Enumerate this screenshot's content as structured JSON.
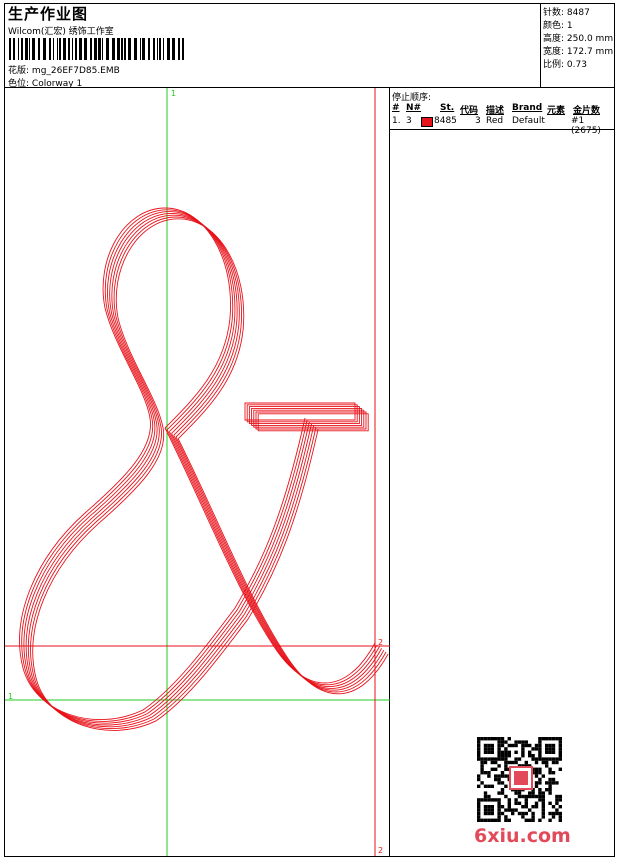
{
  "header": {
    "title": "生产作业图",
    "company": "Wilcom(汇宏) 绣饰工作室",
    "design_label": "花版:",
    "design_name": "mg_26EF7D85.EMB",
    "colorway_label": "色位:",
    "colorway_name": "Colorway 1"
  },
  "stats": [
    {
      "label": "针数:",
      "value": "8487"
    },
    {
      "label": "颜色:",
      "value": "1"
    },
    {
      "label": "高度:",
      "value": "250.0 mm"
    },
    {
      "label": "宽度:",
      "value": "172.7 mm"
    },
    {
      "label": "比例:",
      "value": "0.73"
    }
  ],
  "stop_sequence": {
    "heading": "停止顺序:",
    "columns": [
      "#",
      "N#",
      "St.",
      "代码",
      "描述",
      "Brand",
      "元素",
      "金片数"
    ],
    "rows": [
      {
        "index": "1.",
        "needle": "3",
        "swatch_color": "#e8121a",
        "stitches": "8485",
        "code": "3",
        "desc": "Red",
        "brand": "Default",
        "element": "#1 (2675)"
      }
    ]
  },
  "guides": {
    "green_v": "1",
    "green_h": "1",
    "red_h": "2",
    "red_v": "2"
  },
  "thread_color": "#e8121a",
  "guide_green": "#22cc22",
  "watermark": "6xiu.com"
}
